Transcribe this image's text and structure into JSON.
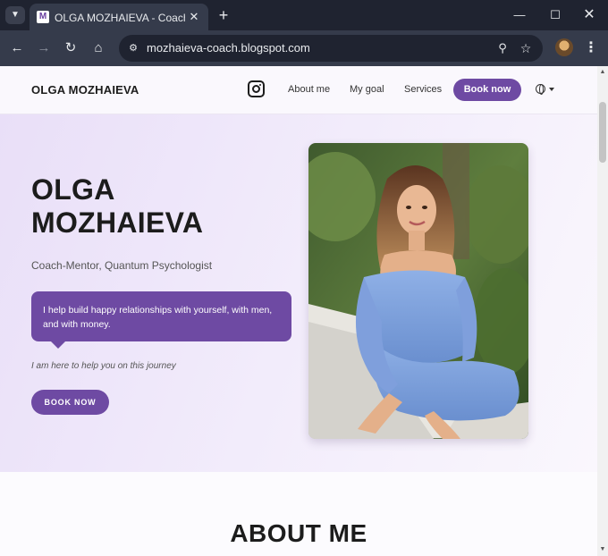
{
  "browser": {
    "tab_title": "OLGA MOZHAIEVA - Coach-Mentor, Quantum Psychologist",
    "favicon_letter": "M",
    "url": "mozhaieva-coach.blogspot.com"
  },
  "icons": {
    "tab_menu": "chevron-down-icon",
    "close": "close-icon",
    "new_tab": "plus-icon",
    "back": "arrow-left-icon",
    "forward": "arrow-right-icon",
    "reload": "reload-icon",
    "home": "home-icon",
    "site_info": "tune-icon",
    "zoom": "zoom-icon",
    "bookmark": "star-icon",
    "menu": "kebab-icon",
    "instagram": "instagram-icon",
    "language": "globe-icon"
  },
  "header": {
    "brand": "OLGA MOZHAIEVA",
    "nav": [
      "About me",
      "My goal",
      "Services"
    ],
    "book_label": "Book now"
  },
  "hero": {
    "name": "OLGA MOZHAIEVA",
    "subtitle": "Coach-Mentor, Quantum Psychologist",
    "bubble": "I help build happy relationships with yourself, with men, and with money.",
    "note": "I am here to help you on this journey",
    "button": "BOOK NOW"
  },
  "about": {
    "title": "ABOUT ME"
  },
  "colors": {
    "accent": "#6e4aa3",
    "hero_bg": "#ede4f9",
    "chrome_dark": "#1f2330",
    "chrome_toolbar": "#353b4b"
  }
}
